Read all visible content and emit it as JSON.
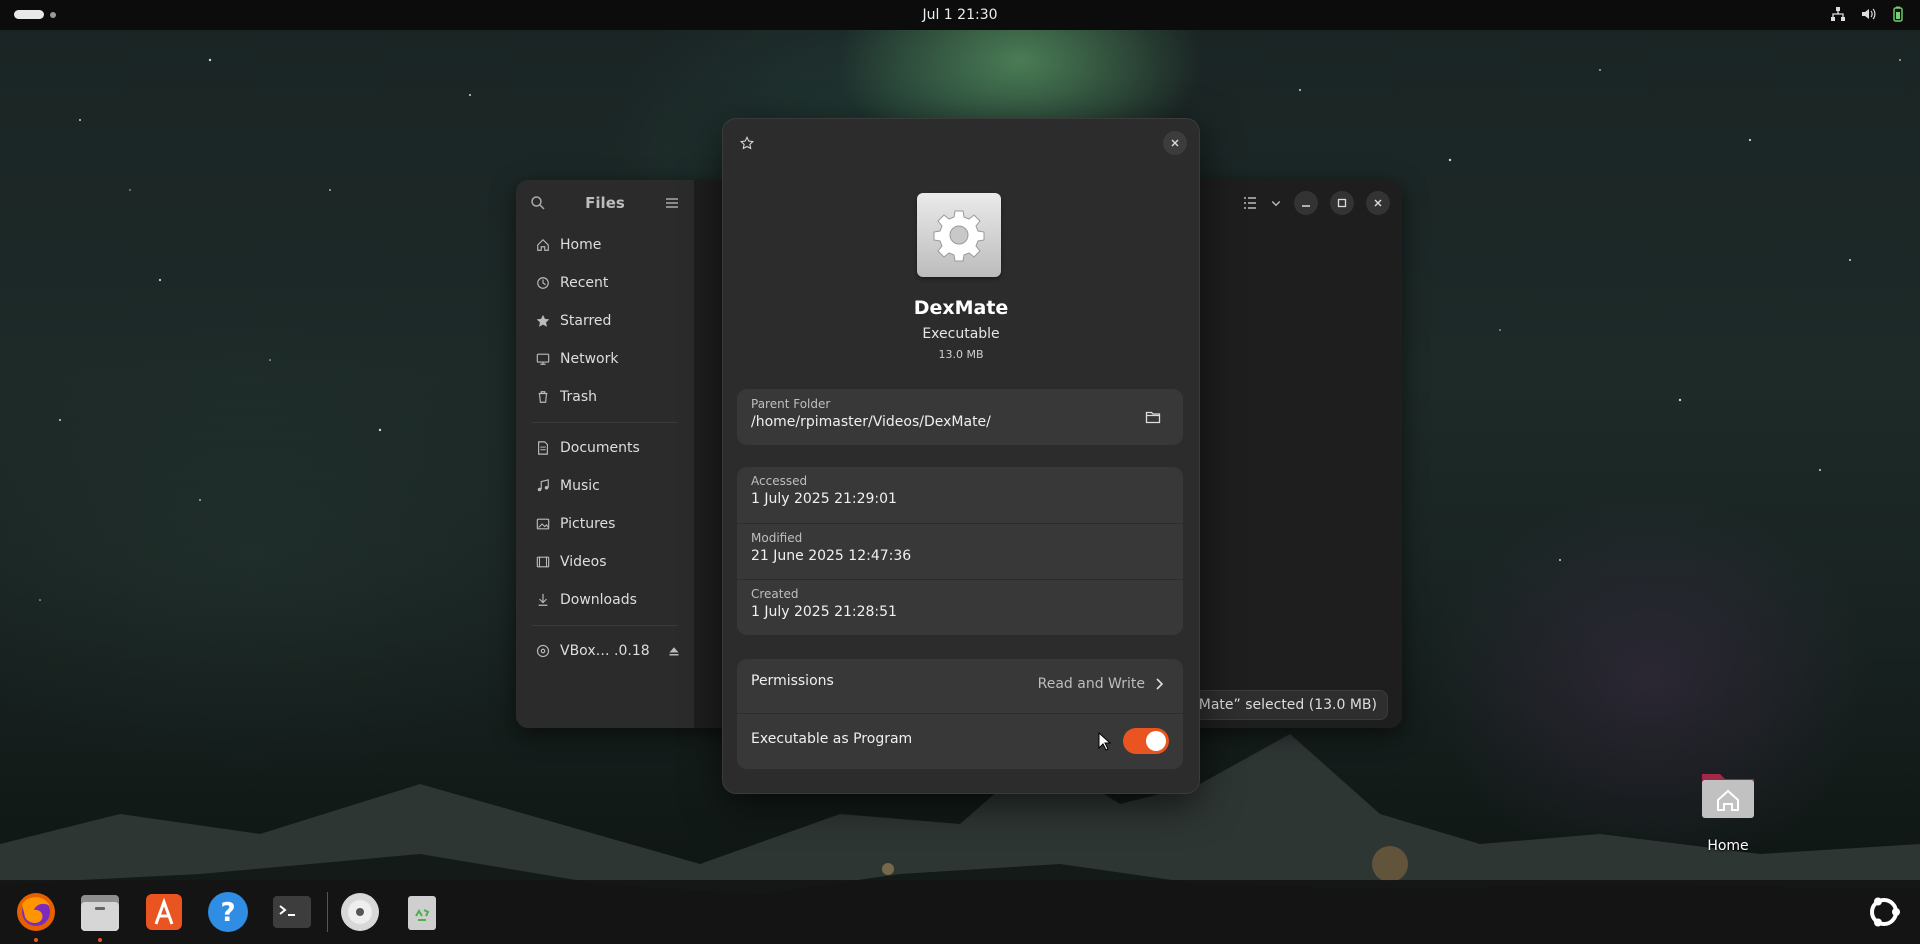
{
  "topbar": {
    "clock": "Jul 1  21:30"
  },
  "files_window": {
    "title": "Files",
    "sidebar": [
      {
        "label": "Home",
        "icon": "home-icon"
      },
      {
        "label": "Recent",
        "icon": "clock-icon"
      },
      {
        "label": "Starred",
        "icon": "star-icon"
      },
      {
        "label": "Network",
        "icon": "network-icon"
      },
      {
        "label": "Trash",
        "icon": "trash-icon"
      },
      {
        "label": "Documents",
        "icon": "document-icon"
      },
      {
        "label": "Music",
        "icon": "music-icon"
      },
      {
        "label": "Pictures",
        "icon": "picture-icon"
      },
      {
        "label": "Videos",
        "icon": "video-icon"
      },
      {
        "label": "Downloads",
        "icon": "download-icon"
      },
      {
        "label": "VBox… .0.18",
        "icon": "disc-icon"
      }
    ],
    "status": "DexMate” selected  (13.0 MB)"
  },
  "properties": {
    "name": "DexMate",
    "type": "Executable",
    "size": "13.0 MB",
    "parent_folder_label": "Parent Folder",
    "parent_folder": "/home/rpimaster/Videos/DexMate/",
    "accessed_label": "Accessed",
    "accessed": "1 July 2025 21:29:01",
    "modified_label": "Modified",
    "modified": "21 June 2025 12:47:36",
    "created_label": "Created",
    "created": "1 July 2025 21:28:51",
    "permissions_label": "Permissions",
    "permissions_value": "Read and Write",
    "executable_label": "Executable as Program",
    "executable_on": true
  },
  "desktop": {
    "home_label": "Home"
  },
  "colors": {
    "accent": "#e95420",
    "panel": "#2c2c2c",
    "card": "#383838"
  }
}
